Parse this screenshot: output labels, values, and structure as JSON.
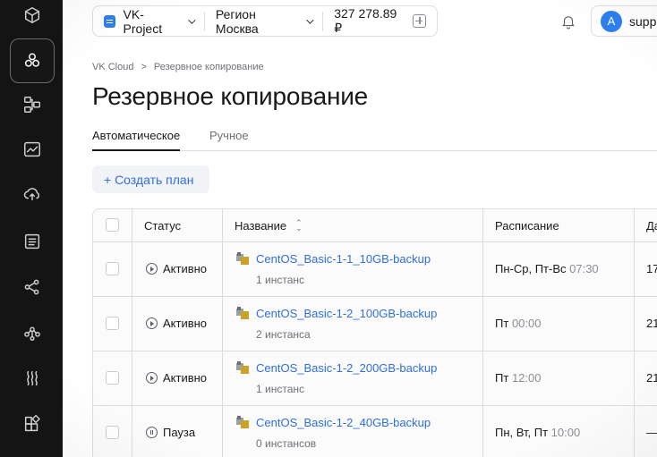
{
  "sidebar": {
    "items": [
      {
        "name": "cube-icon",
        "active": false
      },
      {
        "name": "services-icon",
        "active": true
      },
      {
        "name": "network-icon",
        "active": false
      },
      {
        "name": "monitoring-icon",
        "active": false
      },
      {
        "name": "cloud-upload-icon",
        "active": false
      },
      {
        "name": "list-icon",
        "active": false
      },
      {
        "name": "share-icon",
        "active": false
      },
      {
        "name": "nodes-icon",
        "active": false
      },
      {
        "name": "heat-icon",
        "active": false
      },
      {
        "name": "apps-icon",
        "active": false
      }
    ]
  },
  "topbar": {
    "project": "VK-Project",
    "region": "Регион Москва",
    "balance": "327 278.89 ₽",
    "user_initial": "A",
    "user_name": "suppo"
  },
  "breadcrumb": {
    "root": "VK Cloud",
    "separator": ">",
    "current": "Резервное копирование"
  },
  "page": {
    "title": "Резервное копирование"
  },
  "tabs": [
    {
      "label": "Автоматическое",
      "active": true
    },
    {
      "label": "Ручное",
      "active": false
    }
  ],
  "create_button": "+ Создать план",
  "table": {
    "headers": {
      "status": "Статус",
      "name": "Название",
      "schedule": "Расписание",
      "next": "Да"
    },
    "rows": [
      {
        "status": "Активно",
        "status_icon": "play",
        "name": "CentOS_Basic-1-1_10GB-backup",
        "instances": "1 инстанс",
        "schedule_days": "Пн-Ср, Пт-Вс",
        "schedule_time": "07:30",
        "next": "17"
      },
      {
        "status": "Активно",
        "status_icon": "play",
        "name": "CentOS_Basic-1-2_100GB-backup",
        "instances": "2 инстанса",
        "schedule_days": "Пт",
        "schedule_time": "00:00",
        "next": "21"
      },
      {
        "status": "Активно",
        "status_icon": "play",
        "name": "CentOS_Basic-1-2_200GB-backup",
        "instances": "1 инстанс",
        "schedule_days": "Пт",
        "schedule_time": "12:00",
        "next": "21"
      },
      {
        "status": "Пауза",
        "status_icon": "pause",
        "name": "CentOS_Basic-1-2_40GB-backup",
        "instances": "0 инстансов",
        "schedule_days": "Пн, Вт, Пт",
        "schedule_time": "10:00",
        "next": "—"
      }
    ]
  }
}
